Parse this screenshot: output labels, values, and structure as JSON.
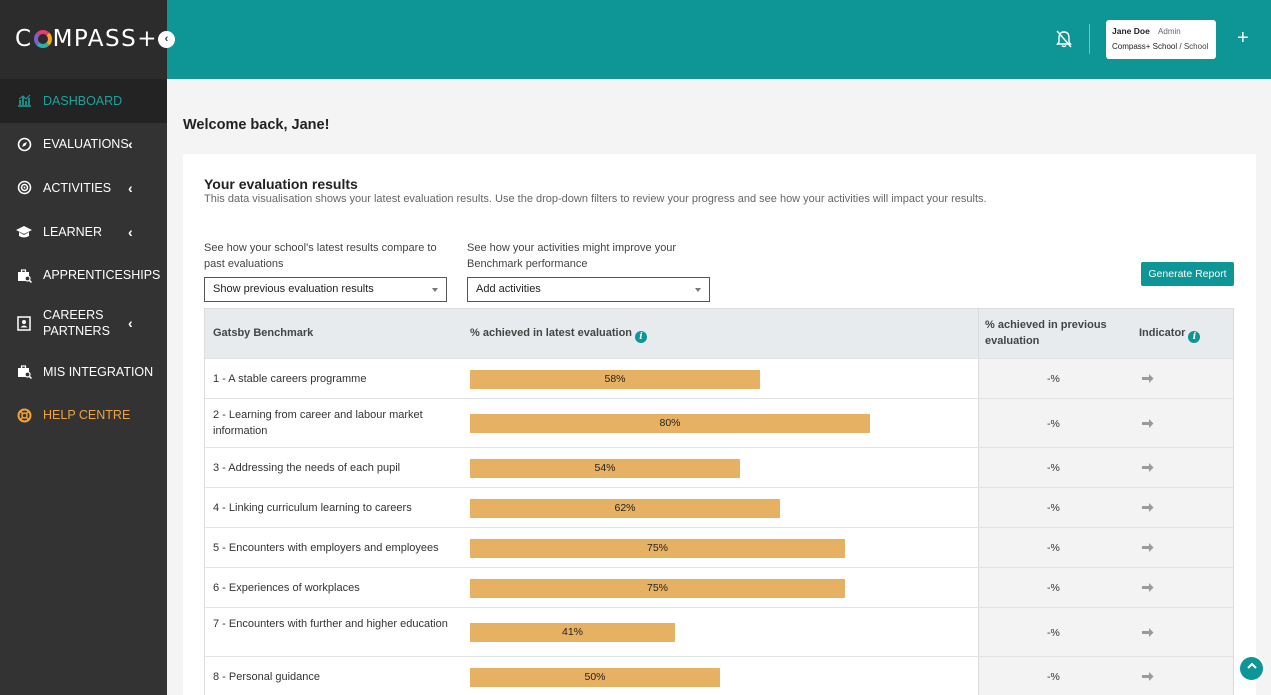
{
  "logo": {
    "text_left": "C",
    "text_right": "MPASS+"
  },
  "sidebar": {
    "collapse_icon": "chevron-left-icon",
    "items": [
      {
        "label": "DASHBOARD",
        "icon": "chart-icon"
      },
      {
        "label": "EVALUATIONS",
        "icon": "compass-icon"
      },
      {
        "label": "ACTIVITIES",
        "icon": "target-icon"
      },
      {
        "label": "LEARNER",
        "icon": "graduation-cap-icon"
      },
      {
        "label": "APPRENTICESHIPS",
        "icon": "briefcase-search-icon"
      },
      {
        "label": "CAREERS PARTNERS",
        "icon": "contact-card-icon"
      },
      {
        "label": "MIS INTEGRATION",
        "icon": "briefcase-search-icon"
      },
      {
        "label": "HELP CENTRE",
        "icon": "lifebuoy-icon"
      }
    ]
  },
  "header": {
    "user_name": "Jane Doe",
    "user_role": "Admin",
    "school": "Compass+ School",
    "school_type": "/ School",
    "plus": "+"
  },
  "main": {
    "welcome": "Welcome back, Jane!",
    "card_title": "Your evaluation results",
    "card_desc": "This data visualisation shows your latest evaluation results. Use the drop-down filters to review your progress and see how your activities will impact your results.",
    "filter1_label": "See how your school's latest results compare to past evaluations",
    "filter1_value": "Show previous evaluation results",
    "filter2_label": "See how your activities might improve your Benchmark performance",
    "filter2_value": "Add activities",
    "generate_button": "Generate Report"
  },
  "table": {
    "headers": {
      "benchmark": "Gatsby Benchmark",
      "latest": "% achieved in latest evaluation",
      "previous": "% achieved in previous evaluation",
      "indicator": "Indicator"
    },
    "rows": [
      {
        "name": "1 - A stable careers programme",
        "value": 58,
        "label": "58%",
        "prev": "-%"
      },
      {
        "name": "2 - Learning from career and labour market information",
        "value": 80,
        "label": "80%",
        "prev": "-%"
      },
      {
        "name": "3 - Addressing the needs of each pupil",
        "value": 54,
        "label": "54%",
        "prev": "-%"
      },
      {
        "name": "4 - Linking curriculum learning to careers",
        "value": 62,
        "label": "62%",
        "prev": "-%"
      },
      {
        "name": "5 - Encounters with employers and employees",
        "value": 75,
        "label": "75%",
        "prev": "-%"
      },
      {
        "name": "6 - Experiences of workplaces",
        "value": 75,
        "label": "75%",
        "prev": "-%"
      },
      {
        "name": "7 - Encounters with further and higher education",
        "value": 41,
        "label": "41%",
        "prev": "-%"
      },
      {
        "name": "8 - Personal guidance",
        "value": 50,
        "label": "50%",
        "prev": "-%"
      }
    ]
  },
  "colors": {
    "brand": "#0e9596",
    "bar": "#e7b163",
    "sidebar": "#333333",
    "help": "#f0a33a"
  }
}
